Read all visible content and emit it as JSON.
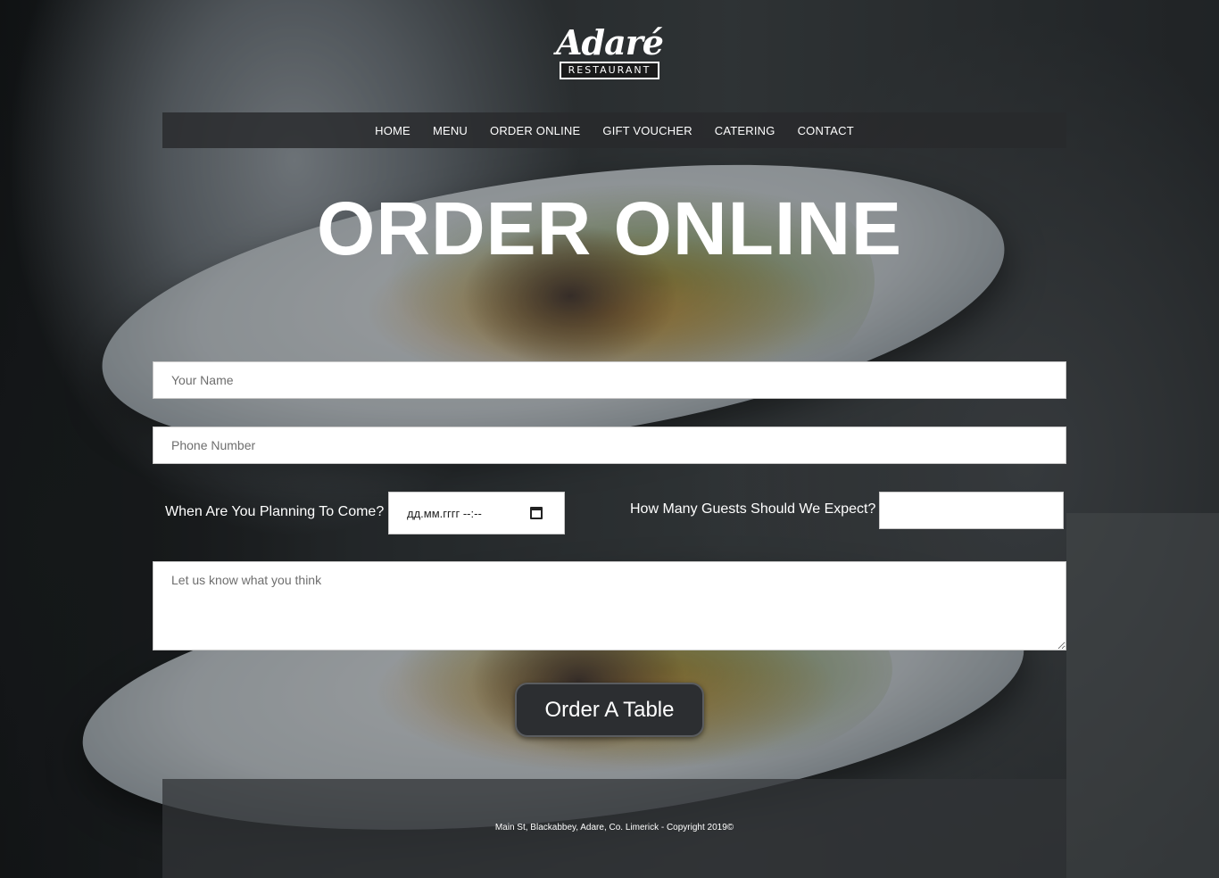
{
  "logo": {
    "script": "Adaré",
    "sub": "RESTAURANT"
  },
  "nav": {
    "items": [
      {
        "label": "HOME"
      },
      {
        "label": "MENU"
      },
      {
        "label": "ORDER ONLINE"
      },
      {
        "label": "GIFT VOUCHER"
      },
      {
        "label": "CATERING"
      },
      {
        "label": "CONTACT"
      }
    ]
  },
  "hero": {
    "title": "ORDER ONLINE"
  },
  "form": {
    "name_placeholder": "Your Name",
    "phone_placeholder": "Phone Number",
    "date_label": "When Are You Planning To Come?",
    "date_value": "дд.мм.гггг --:--",
    "guests_label": "How Many Guests Should We Expect?",
    "guests_value": "",
    "message_placeholder": "Let us know what you think",
    "submit_label": "Order A Table"
  },
  "footer": {
    "text": "Main St, Blackabbey, Adare, Co. Limerick - Copyright 2019©"
  },
  "colors": {
    "button_bg": "#2c2e31",
    "nav_bg": "#28292c",
    "text": "#ffffff"
  },
  "icons": {
    "date_picker": "calendar-icon"
  }
}
